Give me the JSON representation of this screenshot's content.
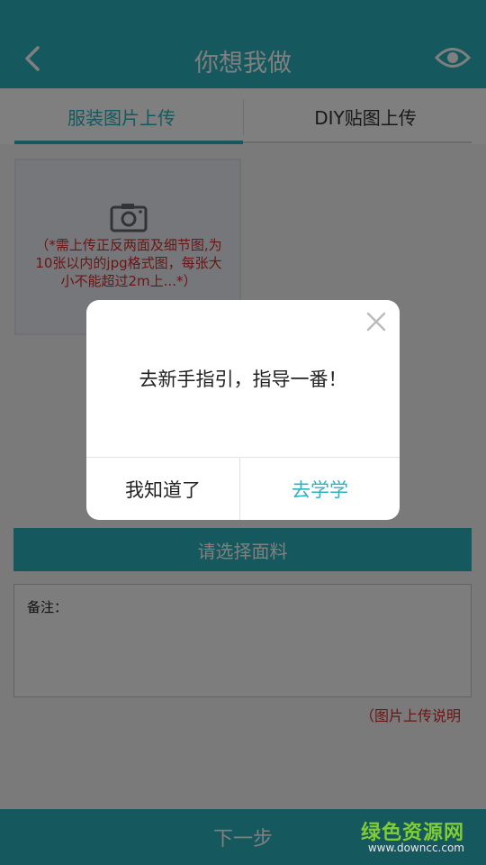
{
  "header": {
    "title": "你想我做",
    "back_icon": "chevron-left-icon",
    "preview_icon": "eye-icon"
  },
  "tabs": [
    {
      "label": "服装图片上传",
      "active": true
    },
    {
      "label": "DIY贴图上传",
      "active": false
    }
  ],
  "upload": {
    "icon": "camera-icon",
    "hint": "（*需上传正反两面及细节图,为10张以内的jpg格式图，每张大小不能超过2m上...*）"
  },
  "fabric_button": "请选择面料",
  "notes": {
    "label": "备注："
  },
  "upload_help_link": "（图片上传说明",
  "next_button": "下一步",
  "dialog": {
    "message": "去新手指引，指导一番！",
    "dismiss_label": "我知道了",
    "confirm_label": "去学学",
    "close_icon": "close-icon"
  },
  "watermark": {
    "brand": "绿色资源网",
    "url": "www.downcc.com"
  },
  "colors": {
    "accent": "#2bb3be",
    "warning": "#d62a2a",
    "watermark": "#7fcc35"
  }
}
